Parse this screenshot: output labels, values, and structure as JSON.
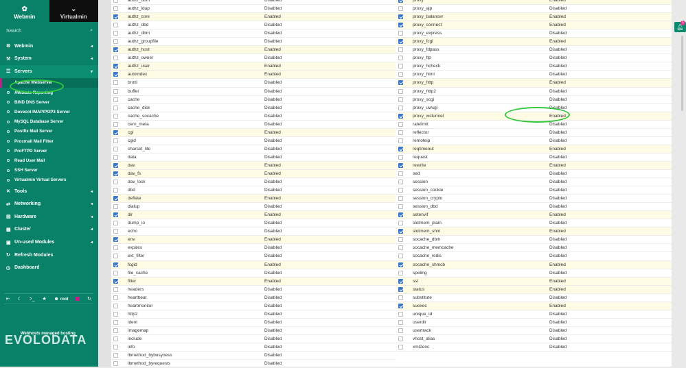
{
  "sidebar": {
    "tabs": [
      {
        "label": "Webmin",
        "icon": "webmin-icon"
      },
      {
        "label": "Virtualmin",
        "icon": "chevron-down-icon"
      }
    ],
    "search_placeholder": "Search",
    "menu_top": [
      {
        "label": "Webmin",
        "icon": "gear-icon"
      },
      {
        "label": "System",
        "icon": "wrench-icon"
      },
      {
        "label": "Servers",
        "icon": "server-icon"
      }
    ],
    "servers_items": [
      "Apache Webserver",
      "AWStats Reporting",
      "BIND DNS Server",
      "Dovecot IMAP/POP3 Server",
      "MySQL Database Server",
      "Postfix Mail Server",
      "Procmail Mail Filter",
      "ProFTPD Server",
      "Read User Mail",
      "SSH Server",
      "Virtualmin Virtual Servers"
    ],
    "menu_bottom": [
      {
        "label": "Tools",
        "icon": "tools-icon",
        "arrow": true
      },
      {
        "label": "Networking",
        "icon": "network-icon",
        "arrow": true
      },
      {
        "label": "Hardware",
        "icon": "hardware-icon",
        "arrow": true
      },
      {
        "label": "Cluster",
        "icon": "cluster-icon",
        "arrow": true
      },
      {
        "label": "Un-used Modules",
        "icon": "box-icon",
        "arrow": true
      },
      {
        "label": "Refresh Modules",
        "icon": "refresh-icon",
        "arrow": false
      },
      {
        "label": "Dashboard",
        "icon": "dashboard-icon",
        "arrow": false
      }
    ],
    "user": "root",
    "brand": "EVOLODATA",
    "tagline": "Webhosts managed hosting",
    "accent": "#098068"
  },
  "status_enabled": "Enabled",
  "status_disabled": "Disabled",
  "modules_left": [
    {
      "name": "authz_dbm",
      "on": false
    },
    {
      "name": "authz_ldap",
      "on": false
    },
    {
      "name": "authz_core",
      "on": true
    },
    {
      "name": "authz_dbd",
      "on": false
    },
    {
      "name": "authz_dbm",
      "on": false
    },
    {
      "name": "authz_groupfile",
      "on": false
    },
    {
      "name": "authz_host",
      "on": true
    },
    {
      "name": "authz_owner",
      "on": false
    },
    {
      "name": "authz_user",
      "on": true
    },
    {
      "name": "autoindex",
      "on": true
    },
    {
      "name": "brotli",
      "on": false
    },
    {
      "name": "buffer",
      "on": false
    },
    {
      "name": "cache",
      "on": false
    },
    {
      "name": "cache_disk",
      "on": false
    },
    {
      "name": "cache_socache",
      "on": false
    },
    {
      "name": "cern_meta",
      "on": false
    },
    {
      "name": "cgi",
      "on": true
    },
    {
      "name": "cgid",
      "on": false
    },
    {
      "name": "charset_lite",
      "on": false
    },
    {
      "name": "data",
      "on": false
    },
    {
      "name": "dav",
      "on": true
    },
    {
      "name": "dav_fs",
      "on": true
    },
    {
      "name": "dav_lock",
      "on": false
    },
    {
      "name": "dbd",
      "on": false
    },
    {
      "name": "deflate",
      "on": true
    },
    {
      "name": "dialup",
      "on": false
    },
    {
      "name": "dir",
      "on": true
    },
    {
      "name": "dump_io",
      "on": false
    },
    {
      "name": "echo",
      "on": false
    },
    {
      "name": "env",
      "on": true
    },
    {
      "name": "expires",
      "on": false
    },
    {
      "name": "ext_filter",
      "on": false
    },
    {
      "name": "fcgid",
      "on": true
    },
    {
      "name": "file_cache",
      "on": false
    },
    {
      "name": "filter",
      "on": true
    },
    {
      "name": "headers",
      "on": false
    },
    {
      "name": "heartbeat",
      "on": false
    },
    {
      "name": "heartmonitor",
      "on": false
    },
    {
      "name": "http2",
      "on": false
    },
    {
      "name": "ident",
      "on": false
    },
    {
      "name": "imagemap",
      "on": false
    },
    {
      "name": "include",
      "on": false
    },
    {
      "name": "info",
      "on": false
    },
    {
      "name": "lbmethod_bybusyness",
      "on": false
    },
    {
      "name": "lbmethod_byrequests",
      "on": false
    }
  ],
  "modules_right": [
    {
      "name": "proxy",
      "on": true
    },
    {
      "name": "proxy_ajp",
      "on": false
    },
    {
      "name": "proxy_balancer",
      "on": true
    },
    {
      "name": "proxy_connect",
      "on": true
    },
    {
      "name": "proxy_express",
      "on": false
    },
    {
      "name": "proxy_fcgi",
      "on": true
    },
    {
      "name": "proxy_fdpass",
      "on": false
    },
    {
      "name": "proxy_ftp",
      "on": false
    },
    {
      "name": "proxy_hcheck",
      "on": false
    },
    {
      "name": "proxy_html",
      "on": false
    },
    {
      "name": "proxy_http",
      "on": true
    },
    {
      "name": "proxy_http2",
      "on": false
    },
    {
      "name": "proxy_scgi",
      "on": false
    },
    {
      "name": "proxy_uwsgi",
      "on": false
    },
    {
      "name": "proxy_wstunnel",
      "on": true
    },
    {
      "name": "ratelimit",
      "on": false
    },
    {
      "name": "reflector",
      "on": false
    },
    {
      "name": "remoteip",
      "on": false
    },
    {
      "name": "reqtimeout",
      "on": true
    },
    {
      "name": "request",
      "on": false
    },
    {
      "name": "rewrite",
      "on": true
    },
    {
      "name": "sed",
      "on": false
    },
    {
      "name": "session",
      "on": false
    },
    {
      "name": "session_cookie",
      "on": false
    },
    {
      "name": "session_crypto",
      "on": false
    },
    {
      "name": "session_dbd",
      "on": false
    },
    {
      "name": "setenvif",
      "on": true
    },
    {
      "name": "slotmem_plain",
      "on": false
    },
    {
      "name": "slotmem_shm",
      "on": true
    },
    {
      "name": "socache_dbm",
      "on": false
    },
    {
      "name": "socache_memcache",
      "on": false
    },
    {
      "name": "socache_redis",
      "on": false
    },
    {
      "name": "socache_shmcb",
      "on": true
    },
    {
      "name": "speling",
      "on": false
    },
    {
      "name": "ssl",
      "on": true
    },
    {
      "name": "status",
      "on": true
    },
    {
      "name": "substitute",
      "on": false
    },
    {
      "name": "suexec",
      "on": true
    },
    {
      "name": "unique_id",
      "on": false
    },
    {
      "name": "userdir",
      "on": false
    },
    {
      "name": "usertrack",
      "on": false
    },
    {
      "name": "vhost_alias",
      "on": false
    },
    {
      "name": "xml2enc",
      "on": false
    }
  ]
}
